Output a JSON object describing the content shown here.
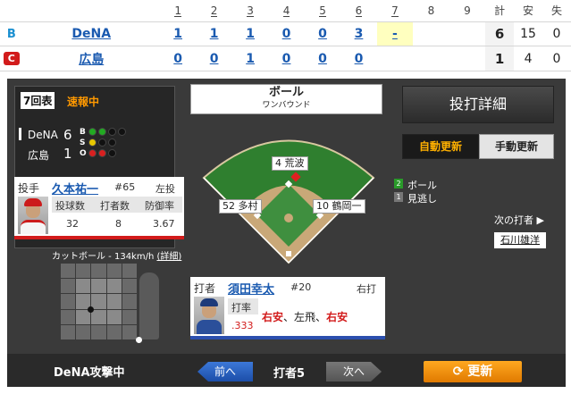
{
  "scoreboard": {
    "innings": [
      "1",
      "2",
      "3",
      "4",
      "5",
      "6",
      "7",
      "8",
      "9"
    ],
    "totals_headers": [
      "計",
      "安",
      "失"
    ],
    "teams": [
      {
        "name": "DeNA",
        "innings": [
          "1",
          "1",
          "1",
          "0",
          "0",
          "3",
          "-",
          "",
          ""
        ],
        "runs": "6",
        "hits": "15",
        "errors": "0",
        "logo": "B"
      },
      {
        "name": "広島",
        "innings": [
          "0",
          "0",
          "1",
          "0",
          "0",
          "0",
          "",
          "",
          ""
        ],
        "runs": "1",
        "hits": "4",
        "errors": "0",
        "logo": "C"
      }
    ]
  },
  "status": {
    "inning": "7回表",
    "live": "速報中",
    "teams": [
      {
        "name": "DeNA",
        "score": "6"
      },
      {
        "name": "広島",
        "score": "1"
      }
    ],
    "bso_letters": [
      "B",
      "S",
      "O"
    ]
  },
  "pitcher": {
    "role": "投手",
    "name": "久本祐一",
    "number": "#65",
    "hand": "左投",
    "headers": [
      "投球数",
      "打者数",
      "防御率"
    ],
    "values": [
      "32",
      "8",
      "3.67"
    ]
  },
  "pitch": {
    "info": "カットボール - 134km/h",
    "detail_link": "(詳細)"
  },
  "field": {
    "title": "ボール",
    "subtitle": "ワンバウンド",
    "positions": {
      "ss": "4 荒波",
      "lf": "52 多村",
      "rf": "10 鶴岡一"
    }
  },
  "batter": {
    "role": "打者",
    "name": "須田幸太",
    "number": "#20",
    "hand": "右打",
    "avg_label": "打率",
    "avg": ".333",
    "results": [
      {
        "text": "右安",
        "hit": true
      },
      {
        "text": "、",
        "hit": false
      },
      {
        "text": "左飛",
        "hit": false
      },
      {
        "text": "、",
        "hit": false
      },
      {
        "text": "右安",
        "hit": true
      }
    ]
  },
  "controls": {
    "detail": "投打詳細",
    "auto": "自動更新",
    "manual": "手動更新",
    "legend": [
      {
        "num": "2",
        "label": "ボール",
        "color": "#2a9a2a"
      },
      {
        "num": "1",
        "label": "見逃し",
        "color": "#777777"
      }
    ],
    "next_batter_label": "次の打者 ▶",
    "next_batter_name": "石川雄洋"
  },
  "bottom": {
    "attack": "DeNA攻撃中",
    "prev": "前へ",
    "batter_num": "打者5",
    "next": "次へ",
    "refresh": "更新"
  }
}
